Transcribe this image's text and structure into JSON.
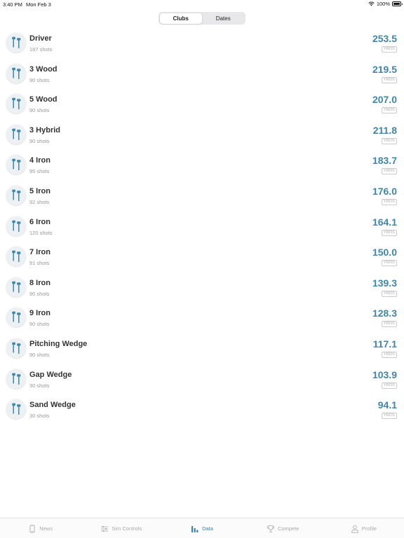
{
  "status_bar": {
    "time": "3:40 PM",
    "date": "Mon Feb 3",
    "battery": "100%"
  },
  "segments": [
    {
      "label": "Clubs",
      "active": true
    },
    {
      "label": "Dates",
      "active": false
    }
  ],
  "clubs": [
    {
      "name": "Driver",
      "shots": "187 shots",
      "distance": "253.5",
      "unit": "YRDS"
    },
    {
      "name": "3 Wood",
      "shots": "90 shots",
      "distance": "219.5",
      "unit": "YRDS"
    },
    {
      "name": "5 Wood",
      "shots": "90 shots",
      "distance": "207.0",
      "unit": "YRDS"
    },
    {
      "name": "3 Hybrid",
      "shots": "90 shots",
      "distance": "211.8",
      "unit": "YRDS"
    },
    {
      "name": "4 Iron",
      "shots": "95 shots",
      "distance": "183.7",
      "unit": "YRDS"
    },
    {
      "name": "5 Iron",
      "shots": "92 shots",
      "distance": "176.0",
      "unit": "YRDS"
    },
    {
      "name": "6 Iron",
      "shots": "120 shots",
      "distance": "164.1",
      "unit": "YRDS"
    },
    {
      "name": "7 Iron",
      "shots": "91 shots",
      "distance": "150.0",
      "unit": "YRDS"
    },
    {
      "name": "8 Iron",
      "shots": "90 shots",
      "distance": "139.3",
      "unit": "YRDS"
    },
    {
      "name": "9 Iron",
      "shots": "90 shots",
      "distance": "128.3",
      "unit": "YRDS"
    },
    {
      "name": "Pitching Wedge",
      "shots": "90 shots",
      "distance": "117.1",
      "unit": "YRDS"
    },
    {
      "name": "Gap Wedge",
      "shots": "30 shots",
      "distance": "103.9",
      "unit": "YRDS"
    },
    {
      "name": "Sand Wedge",
      "shots": "30 shots",
      "distance": "94.1",
      "unit": "YRDS"
    }
  ],
  "club_icon": "golf-clubs-icon",
  "tabs": [
    {
      "label": "News",
      "icon": "phone-icon",
      "active": false
    },
    {
      "label": "Sim Controls",
      "icon": "sliders-icon",
      "active": false
    },
    {
      "label": "Data",
      "icon": "bar-chart-icon",
      "active": true
    },
    {
      "label": "Compete",
      "icon": "trophy-icon",
      "active": false
    },
    {
      "label": "Profile",
      "icon": "person-icon",
      "active": false
    }
  ],
  "colors": {
    "accent": "#3d86ad",
    "muted": "#aaaaaa"
  }
}
